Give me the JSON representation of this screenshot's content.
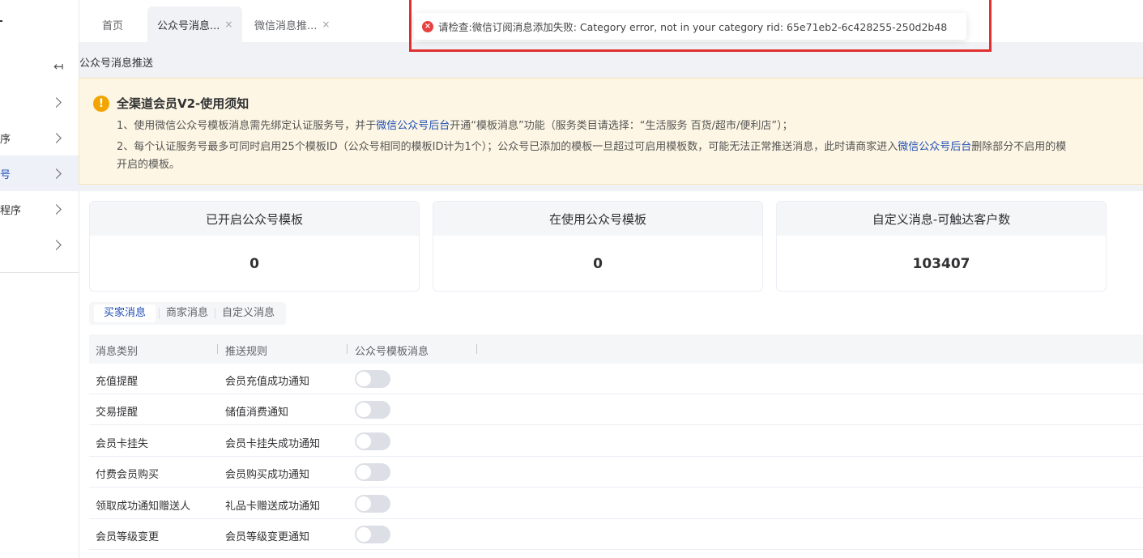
{
  "sidebar": {
    "items": [
      {
        "label": "",
        "active": false
      },
      {
        "label": "序",
        "active": false
      },
      {
        "label": "号",
        "active": true
      },
      {
        "label": "程序",
        "active": false
      },
      {
        "label": "",
        "active": false
      }
    ]
  },
  "tabs": [
    {
      "label": "首页"
    },
    {
      "label": "公众号消息...",
      "close": "×"
    },
    {
      "label": "微信消息推...",
      "close": "×"
    }
  ],
  "breadcrumb": "公众号消息推送",
  "notice": {
    "title": "全渠道会员V2-使用须知",
    "line1_pre": "1、使用微信公众号模板消息需先绑定认证服务号，并于",
    "line1_link": "微信公众号后台",
    "line1_post": "开通“模板消息”功能（服务类目请选择：“生活服务 百货/超市/便利店”）；",
    "line2_pre": "2、每个认证服务号最多可同时启用25个模板ID（公众号相同的模板ID计为1个）；公众号已添加的模板一旦超过可启用模板数，可能无法正常推送消息，此时请商家进入",
    "line2_link": "微信公众号后台",
    "line2_post": "删除部分不启用的模",
    "line3": "开启的模板。"
  },
  "stats": [
    {
      "label": "已开启公众号模板",
      "value": "0"
    },
    {
      "label": "在使用公众号模板",
      "value": "0"
    },
    {
      "label": "自定义消息-可触达客户数",
      "value": "103407"
    }
  ],
  "subtabs": [
    "买家消息",
    "商家消息",
    "自定义消息"
  ],
  "table": {
    "headers": [
      "消息类别",
      "推送规则",
      "公众号模板消息"
    ],
    "rows": [
      {
        "category": "充值提醒",
        "rule": "会员充值成功通知",
        "enabled": false
      },
      {
        "category": "交易提醒",
        "rule": "储值消费通知",
        "enabled": false
      },
      {
        "category": "会员卡挂失",
        "rule": "会员卡挂失成功通知",
        "enabled": false
      },
      {
        "category": "付费会员购买",
        "rule": "会员购买成功通知",
        "enabled": false
      },
      {
        "category": "领取成功通知赠送人",
        "rule": "礼品卡赠送成功通知",
        "enabled": false
      },
      {
        "category": "会员等级变更",
        "rule": "会员等级变更通知",
        "enabled": false
      }
    ]
  },
  "toast": {
    "message": "请检查:微信订阅消息添加失败: Category error, not in your category rid: 65e71eb2-6c428255-250d2b48"
  },
  "colors": {
    "accent": "#1f4fb5",
    "warning": "#f2a500",
    "error": "#e84040"
  }
}
